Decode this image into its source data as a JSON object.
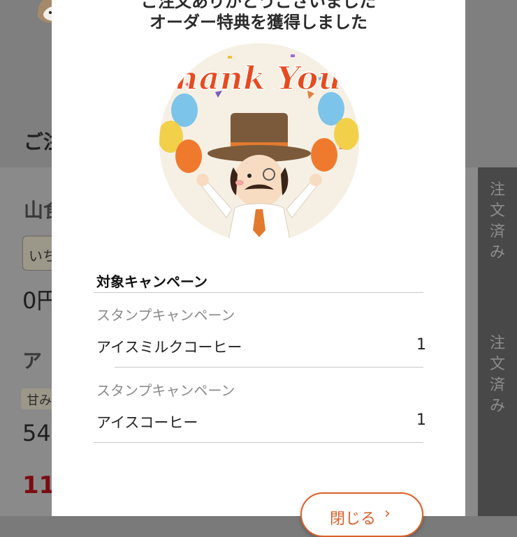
{
  "background": {
    "heading": "ご注",
    "shop_name": "山食",
    "chip1": "いち",
    "price1": "0円",
    "item2": "ア",
    "chip2": "甘み",
    "price2": "54",
    "price3": "11",
    "side_labels": [
      "注文済み",
      "注文済み"
    ]
  },
  "modal": {
    "title_line1": "ご注文ありがとうございました",
    "title_line2": "オーダー特典を獲得しました",
    "image_text": "Thank You !",
    "section_header": "対象キャンペーン",
    "campaigns": [
      {
        "label": "スタンプキャンペーン",
        "item": "アイスミルクコーヒー",
        "qty": "1"
      },
      {
        "label": "スタンプキャンペーン",
        "item": "アイスコーヒー",
        "qty": "1"
      }
    ],
    "close_button": {
      "label": "閉じる",
      "icon": "chevron-right-icon"
    }
  },
  "colors": {
    "accent": "#d9602a",
    "price_red": "#7a0b12"
  }
}
